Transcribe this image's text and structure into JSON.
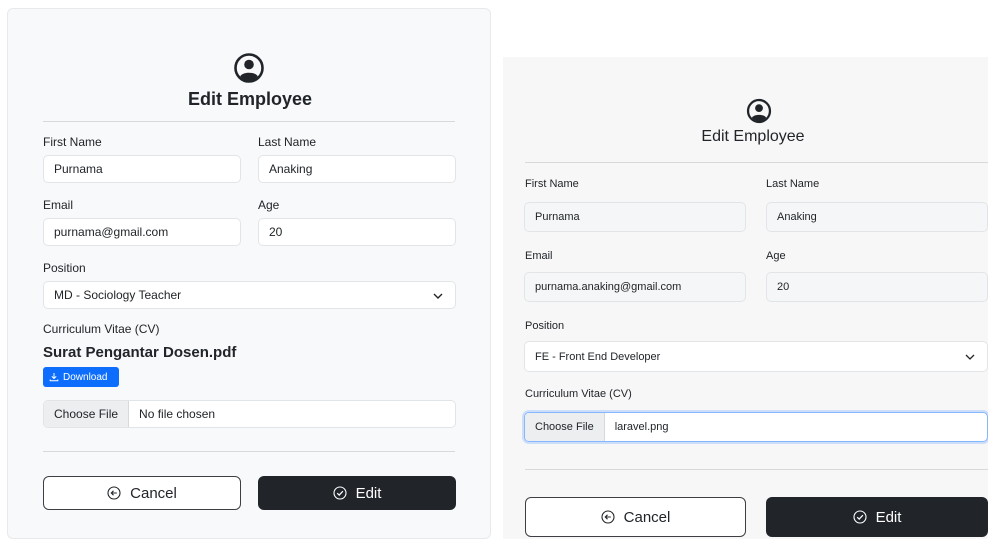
{
  "left_form": {
    "title": "Edit Employee",
    "first_name_label": "First Name",
    "first_name_value": "Purnama",
    "last_name_label": "Last Name",
    "last_name_value": "Anaking",
    "email_label": "Email",
    "email_value": "purnama@gmail.com",
    "age_label": "Age",
    "age_value": "20",
    "position_label": "Position",
    "position_value": "MD - Sociology Teacher",
    "cv_label": "Curriculum Vitae (CV)",
    "cv_file_name": "Surat Pengantar Dosen.pdf",
    "download_label": "Download",
    "choose_file_label": "Choose File",
    "file_status": "No file chosen",
    "cancel_label": "Cancel",
    "edit_label": "Edit"
  },
  "right_form": {
    "title": "Edit Employee",
    "first_name_label": "First Name",
    "first_name_value": "Purnama",
    "last_name_label": "Last Name",
    "last_name_value": "Anaking",
    "email_label": "Email",
    "email_value": "purnama.anaking@gmail.com",
    "age_label": "Age",
    "age_value": "20",
    "position_label": "Position",
    "position_value": "FE - Front End Developer",
    "cv_label": "Curriculum Vitae (CV)",
    "choose_file_label": "Choose File",
    "file_status": "laravel.png",
    "cancel_label": "Cancel",
    "edit_label": "Edit"
  },
  "colors": {
    "primary_dark": "#212529",
    "download_blue": "#0d6efd",
    "focus_border": "#86b7fe"
  },
  "icons": [
    "user-circle-icon",
    "chevron-down-icon",
    "download-icon",
    "arrow-left-circle-icon",
    "check-circle-icon"
  ]
}
